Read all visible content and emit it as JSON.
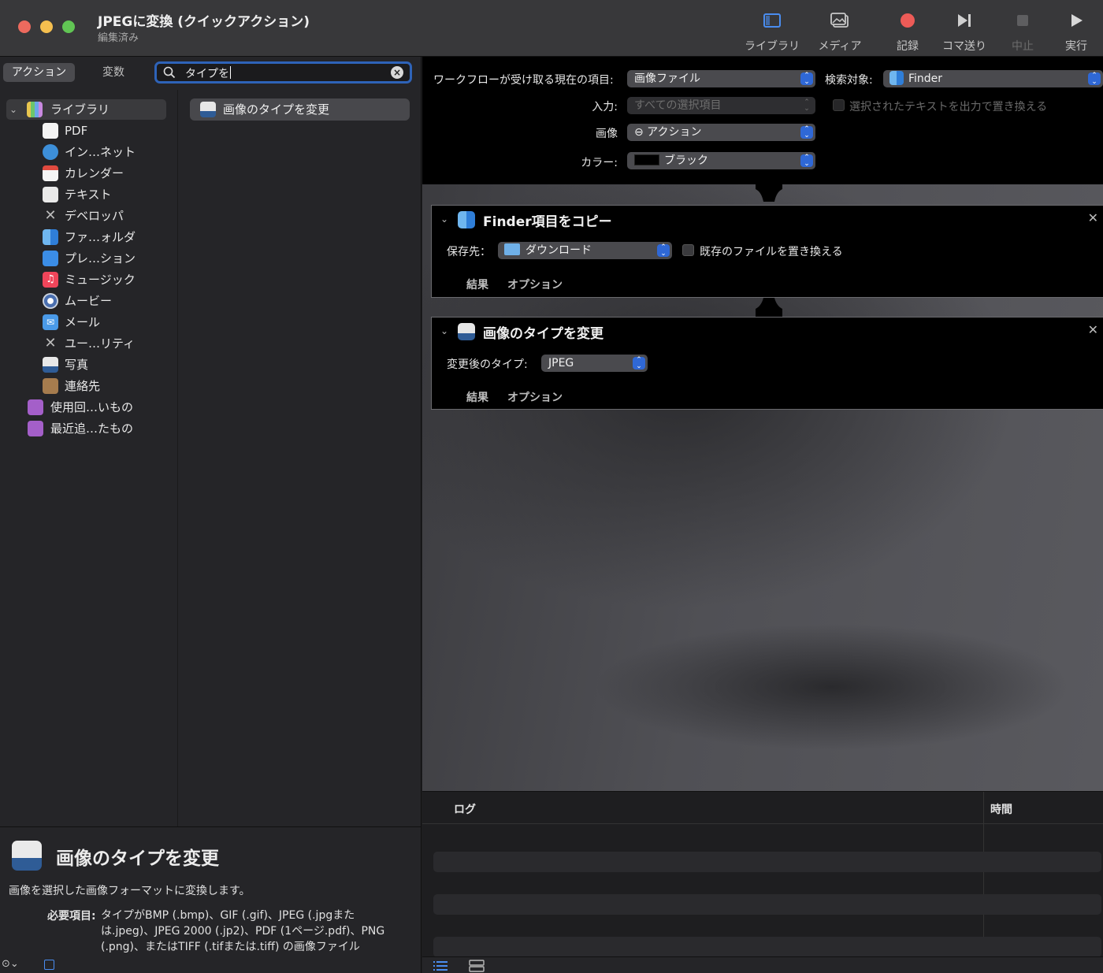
{
  "window": {
    "title": "JPEGに変換 (クイックアクション)",
    "subtitle": "編集済み"
  },
  "toolbar": {
    "library": "ライブラリ",
    "media": "メディア",
    "record": "記録",
    "step": "コマ送り",
    "stop": "中止",
    "run": "実行"
  },
  "tabs": {
    "actions": "アクション",
    "variables": "変数"
  },
  "search": {
    "value": "タイプを"
  },
  "library": {
    "root": "ライブラリ",
    "items": [
      "PDF",
      "イン…ネット",
      "カレンダー",
      "テキスト",
      "デベロッパ",
      "ファ…ォルダ",
      "プレ…ション",
      "ミュージック",
      "ムービー",
      "メール",
      "ユー…リティ",
      "写真",
      "連絡先"
    ],
    "smart": [
      "使用回…いもの",
      "最近追…たもの"
    ]
  },
  "results": {
    "items": [
      "画像のタイプを変更"
    ]
  },
  "description": {
    "title": "画像のタイプを変更",
    "body": "画像を選択した画像フォーマットに変換します。",
    "required_label": "必要項目:",
    "required_text": "タイプがBMP (.bmp)、GIF (.gif)、JPEG (.jpgまたは.jpeg)、JPEG 2000 (.jp2)、PDF (1ページ.pdf)、PNG (.png)、またはTIFF (.tifまたは.tiff) の画像ファイル"
  },
  "workflow": {
    "receives_label": "ワークフローが受け取る現在の項目:",
    "receives_value": "画像ファイル",
    "target_label": "検索対象:",
    "target_value": "Finder",
    "input_label": "入力:",
    "input_value": "すべての選択項目",
    "replace_text_label": "選択されたテキストを出力で置き換える",
    "image_label": "画像",
    "image_value": "⊖ アクション",
    "color_label": "カラー:",
    "color_value": "ブラック"
  },
  "actions": [
    {
      "title": "Finder項目をコピー",
      "field_label": "保存先：",
      "field_value": "ダウンロード",
      "checkbox_label": "既存のファイルを置き換える",
      "results": "結果",
      "options": "オプション"
    },
    {
      "title": "画像のタイプを変更",
      "field_label": "変更後のタイプ:",
      "field_value": "JPEG",
      "results": "結果",
      "options": "オプション"
    }
  ],
  "log": {
    "col_log": "ログ",
    "col_time": "時間"
  },
  "colors": {
    "accent": "#2f68d6",
    "search_ring": "#2e63b8",
    "record": "#ed5b57"
  }
}
